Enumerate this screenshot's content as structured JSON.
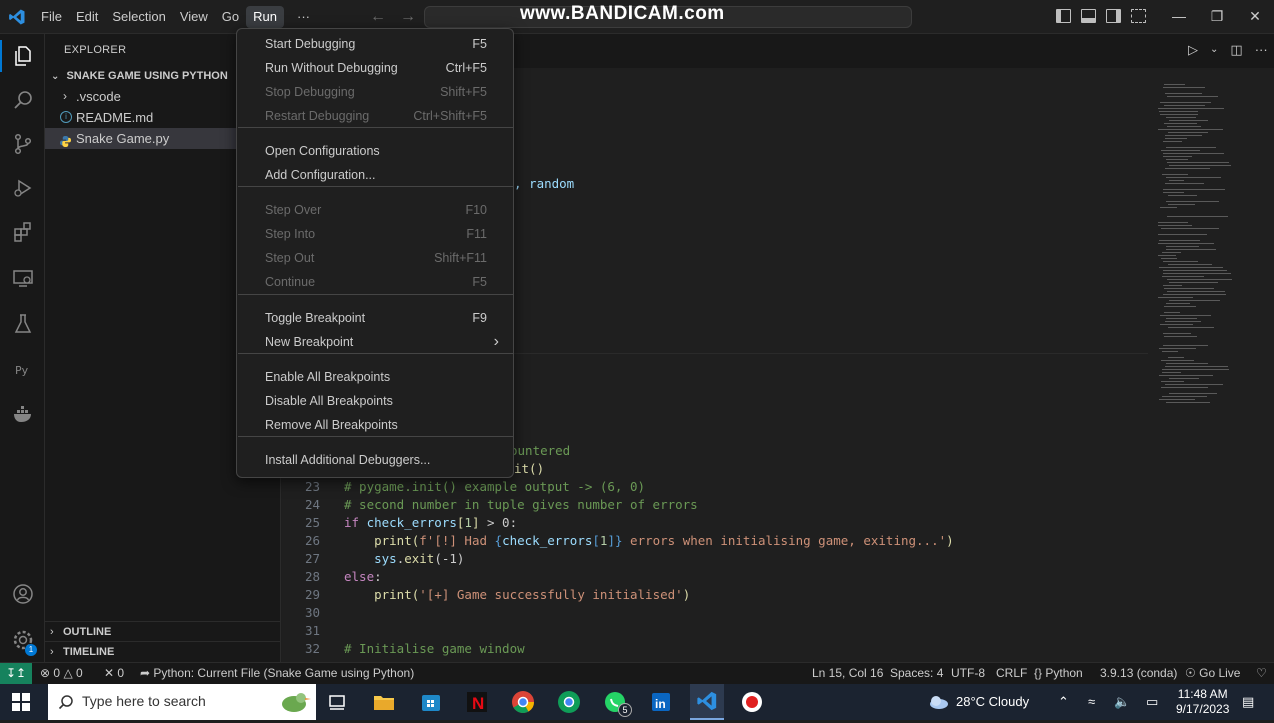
{
  "titlebar": {
    "menus": [
      "File",
      "Edit",
      "Selection",
      "View",
      "Go",
      "Run",
      "···"
    ],
    "active_menu": "Run",
    "watermark": "www.BANDICAM.com"
  },
  "sidebar": {
    "title": "EXPLORER",
    "folder": "SNAKE GAME USING PYTHON",
    "items": [
      {
        "label": ".vscode",
        "icon": "chevron-right"
      },
      {
        "label": "README.md",
        "icon": "info-icon"
      },
      {
        "label": "Snake Game.py",
        "icon": "python-icon"
      }
    ],
    "outline": "OUTLINE",
    "timeline": "TIMELINE"
  },
  "run_menu": {
    "items": [
      {
        "label": "Start Debugging",
        "key": "F5",
        "enabled": true
      },
      {
        "label": "Run Without Debugging",
        "key": "Ctrl+F5",
        "enabled": true
      },
      {
        "label": "Stop Debugging",
        "key": "Shift+F5",
        "enabled": false
      },
      {
        "label": "Restart Debugging",
        "key": "Ctrl+Shift+F5",
        "enabled": false
      },
      {
        "label": "Open Configurations",
        "key": "",
        "enabled": true
      },
      {
        "label": "Add Configuration...",
        "key": "",
        "enabled": true
      },
      {
        "label": "Step Over",
        "key": "F10",
        "enabled": false
      },
      {
        "label": "Step Into",
        "key": "F11",
        "enabled": false
      },
      {
        "label": "Step Out",
        "key": "Shift+F11",
        "enabled": false
      },
      {
        "label": "Continue",
        "key": "F5",
        "enabled": false
      },
      {
        "label": "Toggle Breakpoint",
        "key": "F9",
        "enabled": true
      },
      {
        "label": "New Breakpoint",
        "key": "",
        "enabled": true
      },
      {
        "label": "Enable All Breakpoints",
        "key": "",
        "enabled": true
      },
      {
        "label": "Disable All Breakpoints",
        "key": "",
        "enabled": true
      },
      {
        "label": "Remove All Breakpoints",
        "key": "",
        "enabled": true
      },
      {
        "label": "Install Additional Debuggers...",
        "key": "",
        "enabled": true
      }
    ]
  },
  "editor": {
    "partial_import": ", random",
    "partial_comment": "ountered",
    "partial_call": "it()",
    "lines": [
      {
        "n": "23",
        "text": "# pygame.init() example output -> (6, 0)"
      },
      {
        "n": "24",
        "text": "# second number in tuple gives number of errors"
      },
      {
        "n": "25",
        "kw": "if ",
        "var": "check_errors",
        "b1": "[",
        "num": "1",
        "b2": "]",
        "rest": " > 0:"
      },
      {
        "n": "26",
        "indent": "    ",
        "fn": "print",
        "p1": "(",
        "fpre": "f'[!] Had ",
        "c1": "{",
        "var": "check_errors",
        "ob": "[",
        "num": "1",
        "cb": "]",
        "c2": "}",
        "fpost": " errors when initialising game, exiting...'",
        "p2": ")"
      },
      {
        "n": "27",
        "indent": "    ",
        "var": "sys",
        "dot": ".",
        "fn": "exit",
        "args": "(-1)"
      },
      {
        "n": "28",
        "kw": "else",
        "rest": ":"
      },
      {
        "n": "29",
        "indent": "    ",
        "fn": "print",
        "p1": "(",
        "str": "'[+] Game successfully initialised'",
        "p2": ")"
      },
      {
        "n": "30",
        "text": ""
      },
      {
        "n": "31",
        "text": ""
      },
      {
        "n": "32",
        "text": "# Initialise game window"
      }
    ]
  },
  "statusbar": {
    "errors": "0",
    "warnings": "0",
    "ports": "0",
    "run_config": "Python: Current File (Snake Game using Python)",
    "position": "Ln 15, Col 16",
    "spaces": "Spaces: 4",
    "encoding": "UTF-8",
    "eol": "CRLF",
    "language": "Python",
    "interpreter": "3.9.13 (conda)",
    "golive": "Go Live"
  },
  "taskbar": {
    "search_placeholder": "Type here to search",
    "weather": "28°C  Cloudy",
    "time": "11:48 AM",
    "date": "9/17/2023",
    "whatsapp_badge": "5"
  }
}
